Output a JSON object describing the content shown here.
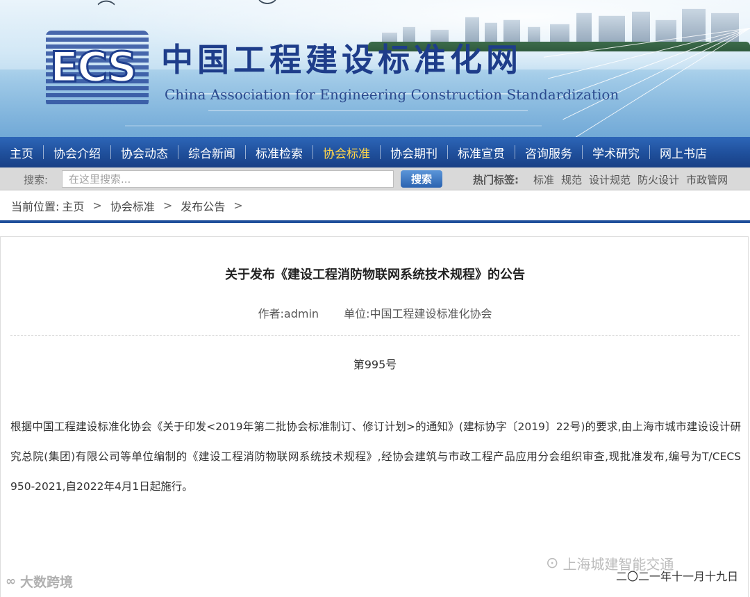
{
  "header": {
    "title": "中国工程建设标准化网",
    "subtitle": "China Association for Engineering Construction Standardization",
    "logo_text": "ECS"
  },
  "nav": {
    "items": [
      {
        "label": "主页",
        "active": false
      },
      {
        "label": "协会介绍",
        "active": false
      },
      {
        "label": "协会动态",
        "active": false
      },
      {
        "label": "综合新闻",
        "active": false
      },
      {
        "label": "标准检索",
        "active": false
      },
      {
        "label": "协会标准",
        "active": true
      },
      {
        "label": "协会期刊",
        "active": false
      },
      {
        "label": "标准宣贯",
        "active": false
      },
      {
        "label": "咨询服务",
        "active": false
      },
      {
        "label": "学术研究",
        "active": false
      },
      {
        "label": "网上书店",
        "active": false
      }
    ]
  },
  "search": {
    "label": "搜索:",
    "placeholder": "在这里搜索...",
    "button_label": "搜索",
    "hot_label": "热门标签:",
    "hot_tags": [
      "标准",
      "规范",
      "设计规范",
      "防火设计",
      "市政管网"
    ]
  },
  "breadcrumb": {
    "prefix": "当前位置:",
    "items": [
      "主页",
      "协会标准",
      "发布公告"
    ],
    "separator": ">"
  },
  "article": {
    "title": "关于发布《建设工程消防物联网系统技术规程》的公告",
    "author": "作者:admin",
    "unit": "单位:中国工程建设标准化协会",
    "number": "第995号",
    "body": "根据中国工程建设标准化协会《关于印发<2019年第二批协会标准制订、修订计划>的通知》(建标协字〔2019〕22号)的要求,由上海市城市建设设计研究总院(集团)有限公司等单位编制的《建设工程消防物联网系统技术规程》,经协会建筑与市政工程产品应用分会组织审查,现批准发布,编号为T/CECS 950-2021,自2022年4月1日起施行。",
    "date": "二〇二一年十一月十九日"
  },
  "watermarks": {
    "left": "大数跨境",
    "right": "上海城建智能交通"
  },
  "colors": {
    "nav_bg": "#1f4f9b",
    "nav_active": "#ffd54a",
    "title_blue": "#1e3d8a"
  }
}
